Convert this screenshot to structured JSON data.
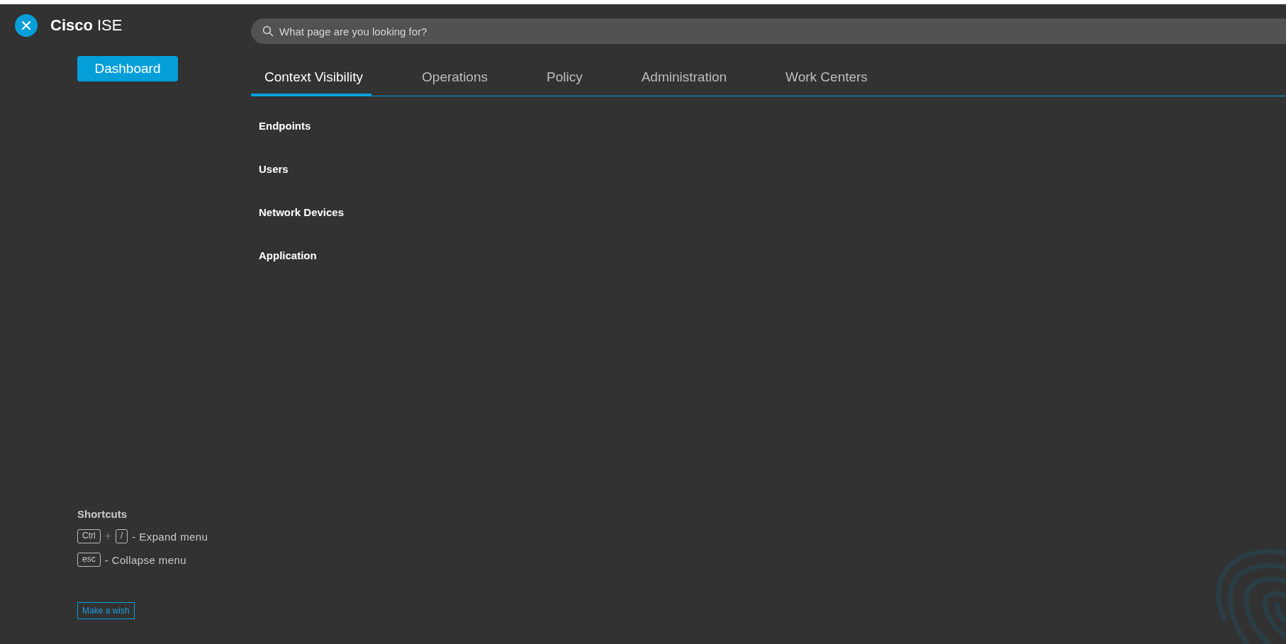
{
  "brand": {
    "bold": "Cisco",
    "rest": "ISE"
  },
  "dashboard_button": "Dashboard",
  "search": {
    "placeholder": "What page are you looking for?"
  },
  "tabs": [
    {
      "label": "Context Visibility",
      "selected": true
    },
    {
      "label": "Operations",
      "selected": false
    },
    {
      "label": "Policy",
      "selected": false
    },
    {
      "label": "Administration",
      "selected": false
    },
    {
      "label": "Work Centers",
      "selected": false
    }
  ],
  "menu_items": [
    "Endpoints",
    "Users",
    "Network Devices",
    "Application"
  ],
  "shortcuts": {
    "title": "Shortcuts",
    "items": [
      {
        "parts": [
          {
            "kind": "key",
            "text": "Ctrl"
          },
          {
            "kind": "plus",
            "text": "+"
          },
          {
            "kind": "key",
            "text": "/"
          }
        ],
        "description": "- Expand menu"
      },
      {
        "parts": [
          {
            "kind": "key",
            "text": "esc"
          }
        ],
        "description": "- Collapse menu"
      }
    ]
  },
  "wish_button": "Make a wish"
}
